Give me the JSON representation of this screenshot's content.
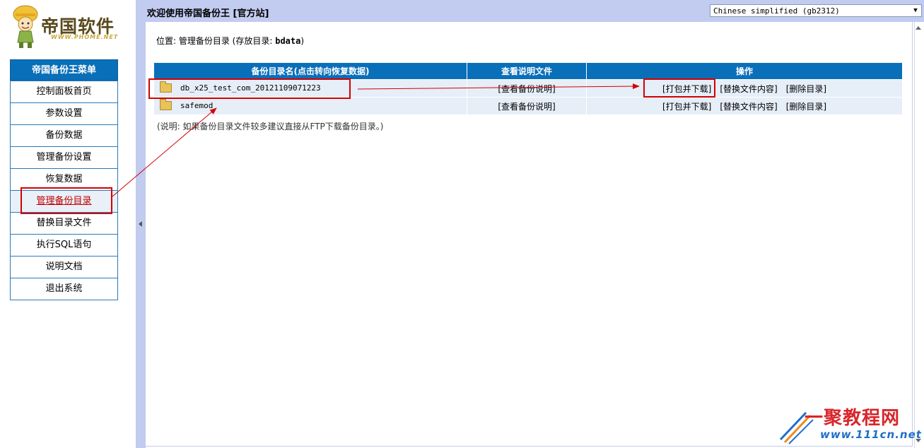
{
  "logo": {
    "text": "帝国软件",
    "subtext": "WWW.PHOME.NET"
  },
  "sidebar": {
    "menu_title": "帝国备份王菜单",
    "items": [
      {
        "label": "控制面板首页"
      },
      {
        "label": "参数设置"
      },
      {
        "label": "备份数据"
      },
      {
        "label": "管理备份设置"
      },
      {
        "label": "恢复数据"
      },
      {
        "label": "管理备份目录",
        "active": true
      },
      {
        "label": "替换目录文件"
      },
      {
        "label": "执行SQL语句"
      },
      {
        "label": "说明文档"
      },
      {
        "label": "退出系统"
      }
    ]
  },
  "header": {
    "welcome": "欢迎使用帝国备份王 [官方站]",
    "language_select": "Chinese simplified (gb2312)"
  },
  "main": {
    "location_prefix": "位置: 管理备份目录 (存放目录: ",
    "location_dir": "bdata",
    "location_suffix": ")",
    "table": {
      "headers": [
        "备份目录名(点击转向恢复数据)",
        "查看说明文件",
        "操作"
      ],
      "rows": [
        {
          "name": "db_x25_test_com_20121109071223",
          "readme": "[查看备份说明]",
          "ops": [
            "[打包并下载]",
            "[替换文件内容]",
            "[删除目录]"
          ]
        },
        {
          "name": "safemod",
          "readme": "[查看备份说明]",
          "ops": [
            "[打包并下载]",
            "[替换文件内容]",
            "[删除目录]"
          ]
        }
      ]
    },
    "note": "(说明: 如果备份目录文件较多建议直接从FTP下载备份目录。)"
  },
  "watermark": {
    "text": "一聚教程网",
    "url": "www.111cn.net"
  },
  "colors": {
    "header_blue": "#0a6fb9",
    "topbar": "#c2cbf0",
    "row_bg": "#e6eef8",
    "annotation_red": "#d40000"
  }
}
